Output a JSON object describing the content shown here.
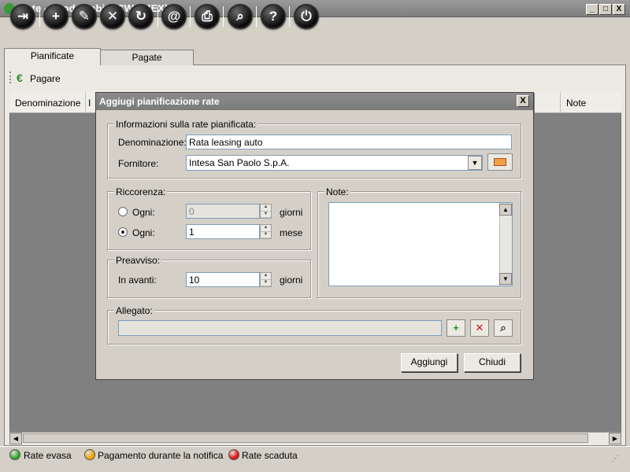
{
  "window": {
    "title": "Rate - Skoda Fabia (CW194EX)",
    "caption_buttons": [
      "_",
      "□",
      "X"
    ]
  },
  "toolbar": {
    "buttons": [
      {
        "name": "exit",
        "glyph": "⇥"
      },
      {
        "name": "add",
        "glyph": "+"
      },
      {
        "name": "edit",
        "glyph": "✎"
      },
      {
        "name": "delete",
        "glyph": "✕"
      },
      {
        "name": "refresh",
        "glyph": "↻"
      },
      {
        "name": "email",
        "glyph": "@"
      },
      {
        "name": "print",
        "glyph": "⎙"
      },
      {
        "name": "search",
        "glyph": "⌕"
      },
      {
        "name": "help",
        "glyph": "?"
      },
      {
        "name": "power",
        "glyph": "⏻"
      }
    ]
  },
  "tabs": [
    "Pianificate",
    "Pagate"
  ],
  "subtoolbar": {
    "pay_icon": "€",
    "pay_label": "Pagare"
  },
  "grid": {
    "columns": [
      "Denominazione",
      "I",
      "Note"
    ]
  },
  "status": {
    "legend": [
      {
        "label": "Rate evasa",
        "color": "#2ea62e"
      },
      {
        "label": "Pagamento durante la notifica",
        "color": "#f4a200"
      },
      {
        "label": "Rate scaduta",
        "color": "#e01010"
      }
    ]
  },
  "dialog": {
    "title": "Aggiugi pianificazione rate",
    "close": "X",
    "info_group": "Informazioni sulla rate pianificata:",
    "denominazione_label": "Denominazione:",
    "denominazione_value": "Rata leasing auto",
    "fornitore_label": "Fornitore:",
    "fornitore_value": "Intesa San Paolo S.p.A.",
    "ricorrenza_group": "Riccorenza:",
    "ogni_label_1": "Ogni:",
    "ogni_value_1": "0",
    "unit_1": "giorni",
    "ogni_label_2": "Ogni:",
    "ogni_value_2": "1",
    "unit_2": "mese",
    "note_group": "Note:",
    "preavviso_group": "Preavviso:",
    "in_avanti_label": "In avanti:",
    "in_avanti_value": "10",
    "preavviso_unit": "giorni",
    "allegato_group": "Allegato:",
    "allegato_value": "",
    "add_button": "Aggiungi",
    "close_button": "Chiudi"
  }
}
